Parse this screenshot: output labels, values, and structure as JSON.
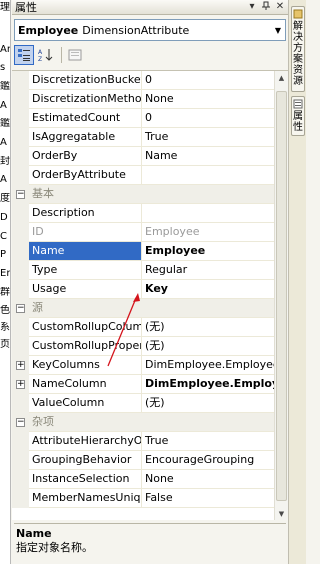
{
  "left_strip": [
    "理",
    "",
    "Ar",
    "s",
    "鑑",
    "A",
    "鑑",
    "A",
    "封",
    "A",
    "度",
    "D",
    "C",
    "P",
    "Er",
    "群",
    "色",
    "系",
    "页"
  ],
  "title": "属性",
  "title_buttons": [
    "▾",
    "📌",
    "✕"
  ],
  "object": {
    "name": "Employee",
    "type": "DimensionAttribute"
  },
  "toolbar": {
    "categorized_label": "按分类",
    "alpha_label": "按字母",
    "pages_label": "属性页"
  },
  "rows": [
    {
      "kind": "prop",
      "name": "DiscretizationBucketCount",
      "value": "0"
    },
    {
      "kind": "prop",
      "name": "DiscretizationMethod",
      "value": "None"
    },
    {
      "kind": "prop",
      "name": "EstimatedCount",
      "value": "0"
    },
    {
      "kind": "prop",
      "name": "IsAggregatable",
      "value": "True"
    },
    {
      "kind": "prop",
      "name": "OrderBy",
      "value": "Name"
    },
    {
      "kind": "prop",
      "name": "OrderByAttribute",
      "value": ""
    },
    {
      "kind": "cat",
      "name": "基本",
      "value": ""
    },
    {
      "kind": "prop",
      "name": "Description",
      "value": ""
    },
    {
      "kind": "prop",
      "name": "ID",
      "value": "Employee",
      "gray": true
    },
    {
      "kind": "prop",
      "name": "Name",
      "value": "Employee",
      "selected": true,
      "bold": true
    },
    {
      "kind": "prop",
      "name": "Type",
      "value": "Regular"
    },
    {
      "kind": "prop",
      "name": "Usage",
      "value": "Key",
      "bold": true
    },
    {
      "kind": "cat",
      "name": "源",
      "value": ""
    },
    {
      "kind": "prop",
      "name": "CustomRollupColumn",
      "value": "(无)"
    },
    {
      "kind": "prop",
      "name": "CustomRollupPropertiesColumn",
      "value": "(无)"
    },
    {
      "kind": "prop",
      "name": "KeyColumns",
      "value": "DimEmployee.EmployeeKey",
      "expand": true
    },
    {
      "kind": "prop",
      "name": "NameColumn",
      "value": "DimEmployee.EmployeeName",
      "expand": true,
      "bold": true
    },
    {
      "kind": "prop",
      "name": "ValueColumn",
      "value": "(无)"
    },
    {
      "kind": "cat",
      "name": "杂项",
      "value": ""
    },
    {
      "kind": "prop",
      "name": "AttributeHierarchyOrdered",
      "value": "True"
    },
    {
      "kind": "prop",
      "name": "GroupingBehavior",
      "value": "EncourageGrouping"
    },
    {
      "kind": "prop",
      "name": "InstanceSelection",
      "value": "None"
    },
    {
      "kind": "prop",
      "name": "MemberNamesUnique",
      "value": "False"
    }
  ],
  "description": {
    "title": "Name",
    "text": "指定对象名称。"
  },
  "right_tabs": [
    {
      "label": "解决方案资源"
    },
    {
      "label": "属性"
    }
  ]
}
